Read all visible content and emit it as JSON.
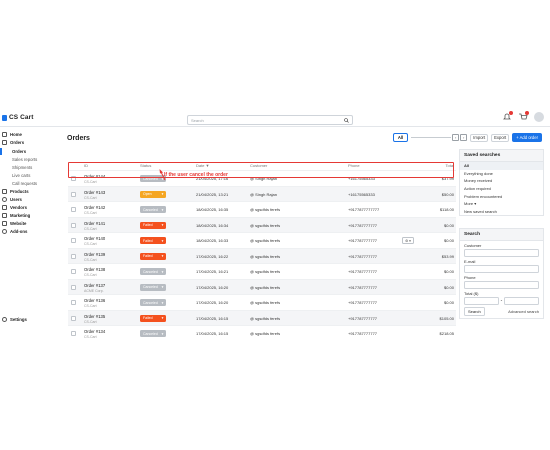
{
  "topbar": {
    "logo_text": "CS Cart",
    "search_placeholder": "Search",
    "icons": [
      "search-icon",
      "bell-icon",
      "cart-icon",
      "user-avatar"
    ]
  },
  "sidebar": {
    "items": [
      {
        "label": "Home",
        "icon": "home-icon",
        "sub": false
      },
      {
        "label": "Orders",
        "icon": "orders-icon",
        "sub": false
      },
      {
        "label": "Orders",
        "sub": true,
        "active": true
      },
      {
        "label": "Sales reports",
        "sub": true
      },
      {
        "label": "Shipments",
        "sub": true
      },
      {
        "label": "Live carts",
        "sub": true
      },
      {
        "label": "Call requests",
        "sub": true
      },
      {
        "label": "Products",
        "icon": "tag-icon",
        "sub": false
      },
      {
        "label": "Users",
        "icon": "users-icon",
        "sub": false
      },
      {
        "label": "Vendors",
        "icon": "vendors-icon",
        "sub": false
      },
      {
        "label": "Marketing",
        "icon": "megaphone-icon",
        "sub": false
      },
      {
        "label": "Website",
        "icon": "website-icon",
        "sub": false
      },
      {
        "label": "Add-ons",
        "icon": "puzzle-icon",
        "sub": false
      }
    ],
    "settings_label": "Settings"
  },
  "header": {
    "title": "Orders",
    "all_label": "All",
    "import_label": "Import",
    "export_label": "Export",
    "add_label": "+ Add order"
  },
  "table": {
    "columns": {
      "id": "ID",
      "status": "Status",
      "date": "Date ▼",
      "customer": "Customer",
      "phone": "Phone",
      "total": "Total"
    },
    "rows": [
      {
        "id": "Order #144",
        "store": "CS-Cart",
        "status": "Canceled",
        "status_color": "gray",
        "date": "21/04/2025, 17:16",
        "customer": "@ Singh Rajan",
        "phone": "+16175565333",
        "total": "$37.99"
      },
      {
        "id": "Order #143",
        "store": "CS-Cart",
        "status": "Open",
        "status_color": "orange",
        "date": "21/04/2025, 13:21",
        "customer": "@ Singh Rajan",
        "phone": "+16175565333",
        "total": "$50.00"
      },
      {
        "id": "Order #142",
        "store": "CS-Cart",
        "status": "Canceled",
        "status_color": "gray",
        "date": "18/04/2025, 16:35",
        "customer": "@ sgsdfds ferefs",
        "phone": "+9177877777777",
        "total": "$118.00"
      },
      {
        "id": "Order #141",
        "store": "CS-Cart",
        "status": "Failed",
        "status_color": "red",
        "date": "18/04/2025, 16:34",
        "customer": "@ sgsdfds ferefs",
        "phone": "+917787777777",
        "total": "$0.00"
      },
      {
        "id": "Order #140",
        "store": "CS-Cart",
        "status": "Failed",
        "status_color": "red",
        "date": "18/04/2025, 16:33",
        "customer": "@ sgsdfds ferefs",
        "phone": "+917787777777",
        "total": "$0.00",
        "gear": true
      },
      {
        "id": "Order #139",
        "store": "CS-Cart",
        "status": "Failed",
        "status_color": "red",
        "date": "17/04/2025, 16:22",
        "customer": "@ sgsdfds ferefs",
        "phone": "+917787777777",
        "total": "$53.99"
      },
      {
        "id": "Order #138",
        "store": "CS-Cart",
        "status": "Canceled",
        "status_color": "gray",
        "date": "17/04/2025, 16:21",
        "customer": "@ sgsdfds ferefs",
        "phone": "+917787777777",
        "total": "$0.00"
      },
      {
        "id": "Order #137",
        "store": "ACME Corp.",
        "status": "Canceled",
        "status_color": "gray",
        "date": "17/04/2025, 16:20",
        "customer": "@ sgsdfds ferefs",
        "phone": "+917787777777",
        "total": "$0.00"
      },
      {
        "id": "Order #136",
        "store": "CS-Cart",
        "status": "Canceled",
        "status_color": "gray",
        "date": "17/04/2025, 16:20",
        "customer": "@ sgsdfds ferefs",
        "phone": "+917787777777",
        "total": "$0.00"
      },
      {
        "id": "Order #135",
        "store": "CS-Cart",
        "status": "Failed",
        "status_color": "red",
        "date": "17/04/2025, 16:15",
        "customer": "@ sgsdfds ferefs",
        "phone": "+917787777777",
        "total": "$105.00"
      },
      {
        "id": "Order #134",
        "store": "CS-Cart",
        "status": "Canceled",
        "status_color": "gray",
        "date": "17/04/2025, 16:15",
        "customer": "@ sgsdfds ferefs",
        "phone": "+917787777777",
        "total": "$218.05"
      }
    ]
  },
  "annotation": {
    "text": "If the user cancel the order",
    "color": "#e53935"
  },
  "saved_searches": {
    "title": "Saved searches",
    "items": [
      "All",
      "Everything done",
      "Money received",
      "Action required",
      "Problem encountered",
      "More ▾",
      "New saved search"
    ]
  },
  "search_panel": {
    "title": "Search",
    "customer_label": "Customer",
    "email_label": "E-mail",
    "phone_label": "Phone",
    "total_label": "Total ($)",
    "range_sep": "-",
    "search_button": "Search",
    "advanced_link": "Advanced search"
  },
  "colors": {
    "accent": "#1a73e8",
    "status_gray": "#b7bcc2",
    "status_orange": "#f5a623",
    "status_red": "#f4511e"
  }
}
